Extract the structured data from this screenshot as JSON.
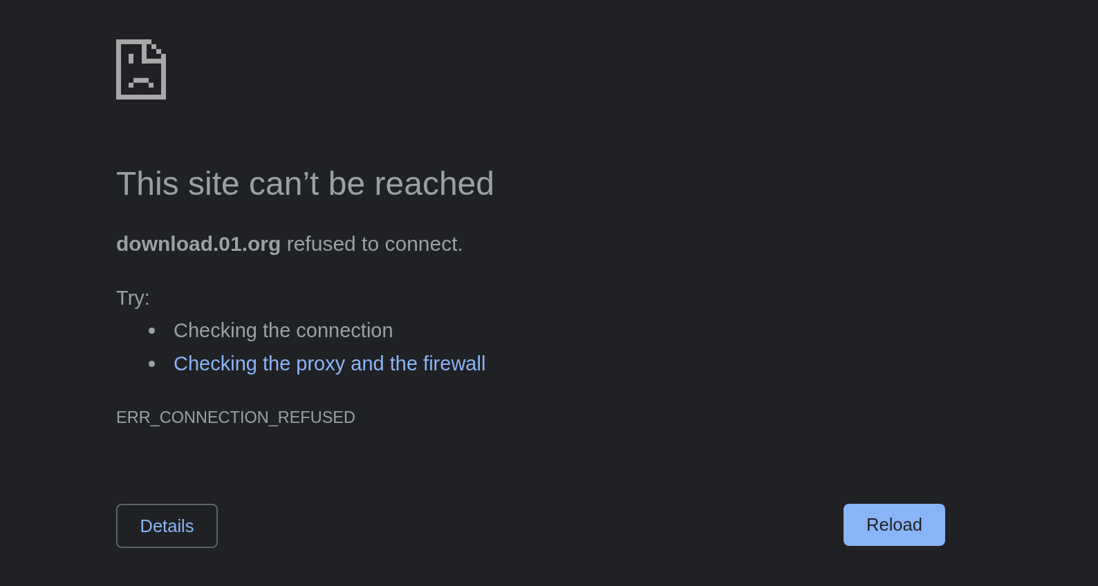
{
  "title": "This site can’t be reached",
  "message": "**download.01.org** refused to connect.",
  "suggestions": {
    "heading": "Try:",
    "items": [
      {
        "kind": "text",
        "text": "Checking the connection"
      },
      {
        "kind": "link",
        "text": "Checking the proxy and the firewall"
      }
    ]
  },
  "error_code": "ERR_CONNECTION_REFUSED",
  "buttons": [
    {
      "kind": "secondary",
      "label": "Details"
    },
    {
      "kind": "primary",
      "label": "Reload"
    }
  ]
}
